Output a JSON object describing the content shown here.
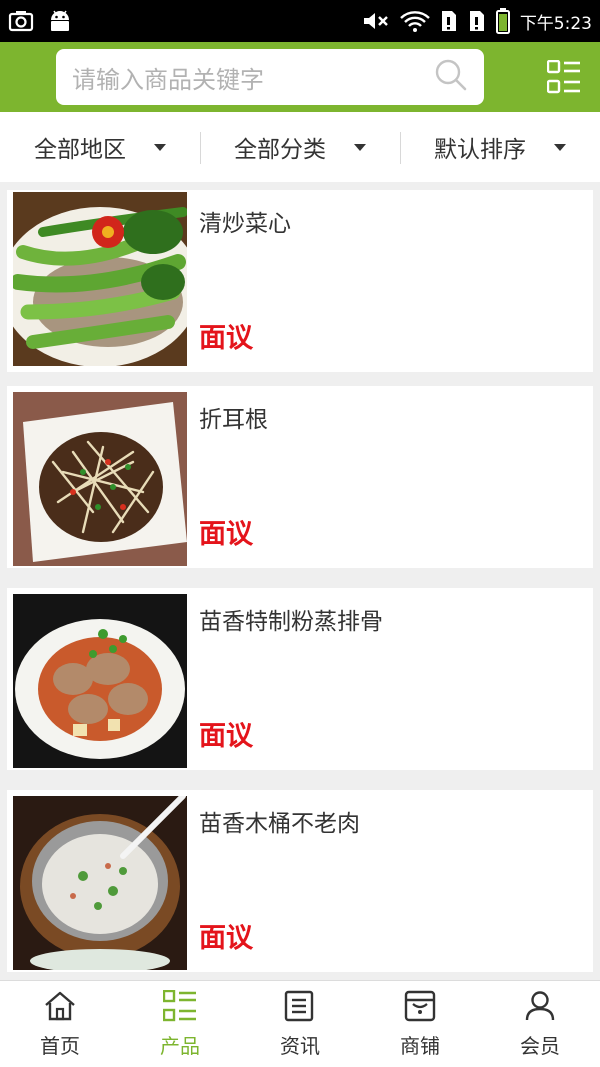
{
  "status_bar": {
    "time": "下午5:23",
    "icons": [
      "camera-icon",
      "android-icon",
      "mute-icon",
      "wifi-icon",
      "sim1-icon",
      "sim2-icon",
      "battery-icon"
    ]
  },
  "header": {
    "search_placeholder": "请输入商品关键字",
    "search_icon": "search-icon",
    "menu_icon": "grid-menu-icon",
    "accent_color": "#7db52f"
  },
  "filters": [
    {
      "label": "全部地区"
    },
    {
      "label": "全部分类"
    },
    {
      "label": "默认排序"
    }
  ],
  "products": [
    {
      "name": "清炒菜心",
      "price": "面议"
    },
    {
      "name": "折耳根",
      "price": "面议"
    },
    {
      "name": "苗香特制粉蒸排骨",
      "price": "面议"
    },
    {
      "name": "苗香木桶不老肉",
      "price": "面议"
    }
  ],
  "price_color": "#e4141b",
  "bottom_nav": [
    {
      "label": "首页",
      "icon": "home-icon",
      "active": false
    },
    {
      "label": "产品",
      "icon": "product-list-icon",
      "active": true
    },
    {
      "label": "资讯",
      "icon": "news-icon",
      "active": false
    },
    {
      "label": "商铺",
      "icon": "shop-icon",
      "active": false
    },
    {
      "label": "会员",
      "icon": "member-icon",
      "active": false
    }
  ]
}
